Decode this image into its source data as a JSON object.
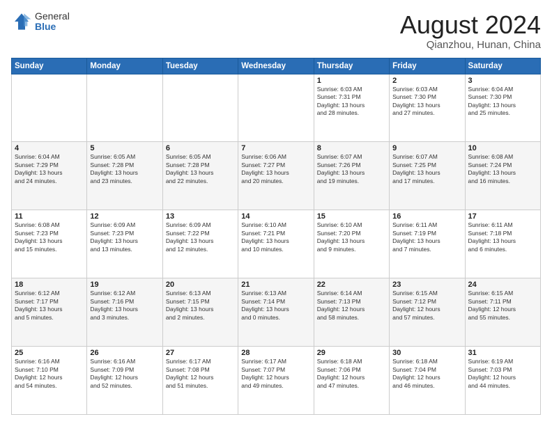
{
  "logo": {
    "general": "General",
    "blue": "Blue"
  },
  "header": {
    "month": "August 2024",
    "location": "Qianzhou, Hunan, China"
  },
  "days_of_week": [
    "Sunday",
    "Monday",
    "Tuesday",
    "Wednesday",
    "Thursday",
    "Friday",
    "Saturday"
  ],
  "weeks": [
    [
      {
        "day": "",
        "info": ""
      },
      {
        "day": "",
        "info": ""
      },
      {
        "day": "",
        "info": ""
      },
      {
        "day": "",
        "info": ""
      },
      {
        "day": "1",
        "info": "Sunrise: 6:03 AM\nSunset: 7:31 PM\nDaylight: 13 hours\nand 28 minutes."
      },
      {
        "day": "2",
        "info": "Sunrise: 6:03 AM\nSunset: 7:30 PM\nDaylight: 13 hours\nand 27 minutes."
      },
      {
        "day": "3",
        "info": "Sunrise: 6:04 AM\nSunset: 7:30 PM\nDaylight: 13 hours\nand 25 minutes."
      }
    ],
    [
      {
        "day": "4",
        "info": "Sunrise: 6:04 AM\nSunset: 7:29 PM\nDaylight: 13 hours\nand 24 minutes."
      },
      {
        "day": "5",
        "info": "Sunrise: 6:05 AM\nSunset: 7:28 PM\nDaylight: 13 hours\nand 23 minutes."
      },
      {
        "day": "6",
        "info": "Sunrise: 6:05 AM\nSunset: 7:28 PM\nDaylight: 13 hours\nand 22 minutes."
      },
      {
        "day": "7",
        "info": "Sunrise: 6:06 AM\nSunset: 7:27 PM\nDaylight: 13 hours\nand 20 minutes."
      },
      {
        "day": "8",
        "info": "Sunrise: 6:07 AM\nSunset: 7:26 PM\nDaylight: 13 hours\nand 19 minutes."
      },
      {
        "day": "9",
        "info": "Sunrise: 6:07 AM\nSunset: 7:25 PM\nDaylight: 13 hours\nand 17 minutes."
      },
      {
        "day": "10",
        "info": "Sunrise: 6:08 AM\nSunset: 7:24 PM\nDaylight: 13 hours\nand 16 minutes."
      }
    ],
    [
      {
        "day": "11",
        "info": "Sunrise: 6:08 AM\nSunset: 7:23 PM\nDaylight: 13 hours\nand 15 minutes."
      },
      {
        "day": "12",
        "info": "Sunrise: 6:09 AM\nSunset: 7:23 PM\nDaylight: 13 hours\nand 13 minutes."
      },
      {
        "day": "13",
        "info": "Sunrise: 6:09 AM\nSunset: 7:22 PM\nDaylight: 13 hours\nand 12 minutes."
      },
      {
        "day": "14",
        "info": "Sunrise: 6:10 AM\nSunset: 7:21 PM\nDaylight: 13 hours\nand 10 minutes."
      },
      {
        "day": "15",
        "info": "Sunrise: 6:10 AM\nSunset: 7:20 PM\nDaylight: 13 hours\nand 9 minutes."
      },
      {
        "day": "16",
        "info": "Sunrise: 6:11 AM\nSunset: 7:19 PM\nDaylight: 13 hours\nand 7 minutes."
      },
      {
        "day": "17",
        "info": "Sunrise: 6:11 AM\nSunset: 7:18 PM\nDaylight: 13 hours\nand 6 minutes."
      }
    ],
    [
      {
        "day": "18",
        "info": "Sunrise: 6:12 AM\nSunset: 7:17 PM\nDaylight: 13 hours\nand 5 minutes."
      },
      {
        "day": "19",
        "info": "Sunrise: 6:12 AM\nSunset: 7:16 PM\nDaylight: 13 hours\nand 3 minutes."
      },
      {
        "day": "20",
        "info": "Sunrise: 6:13 AM\nSunset: 7:15 PM\nDaylight: 13 hours\nand 2 minutes."
      },
      {
        "day": "21",
        "info": "Sunrise: 6:13 AM\nSunset: 7:14 PM\nDaylight: 13 hours\nand 0 minutes."
      },
      {
        "day": "22",
        "info": "Sunrise: 6:14 AM\nSunset: 7:13 PM\nDaylight: 12 hours\nand 58 minutes."
      },
      {
        "day": "23",
        "info": "Sunrise: 6:15 AM\nSunset: 7:12 PM\nDaylight: 12 hours\nand 57 minutes."
      },
      {
        "day": "24",
        "info": "Sunrise: 6:15 AM\nSunset: 7:11 PM\nDaylight: 12 hours\nand 55 minutes."
      }
    ],
    [
      {
        "day": "25",
        "info": "Sunrise: 6:16 AM\nSunset: 7:10 PM\nDaylight: 12 hours\nand 54 minutes."
      },
      {
        "day": "26",
        "info": "Sunrise: 6:16 AM\nSunset: 7:09 PM\nDaylight: 12 hours\nand 52 minutes."
      },
      {
        "day": "27",
        "info": "Sunrise: 6:17 AM\nSunset: 7:08 PM\nDaylight: 12 hours\nand 51 minutes."
      },
      {
        "day": "28",
        "info": "Sunrise: 6:17 AM\nSunset: 7:07 PM\nDaylight: 12 hours\nand 49 minutes."
      },
      {
        "day": "29",
        "info": "Sunrise: 6:18 AM\nSunset: 7:06 PM\nDaylight: 12 hours\nand 47 minutes."
      },
      {
        "day": "30",
        "info": "Sunrise: 6:18 AM\nSunset: 7:04 PM\nDaylight: 12 hours\nand 46 minutes."
      },
      {
        "day": "31",
        "info": "Sunrise: 6:19 AM\nSunset: 7:03 PM\nDaylight: 12 hours\nand 44 minutes."
      }
    ]
  ]
}
